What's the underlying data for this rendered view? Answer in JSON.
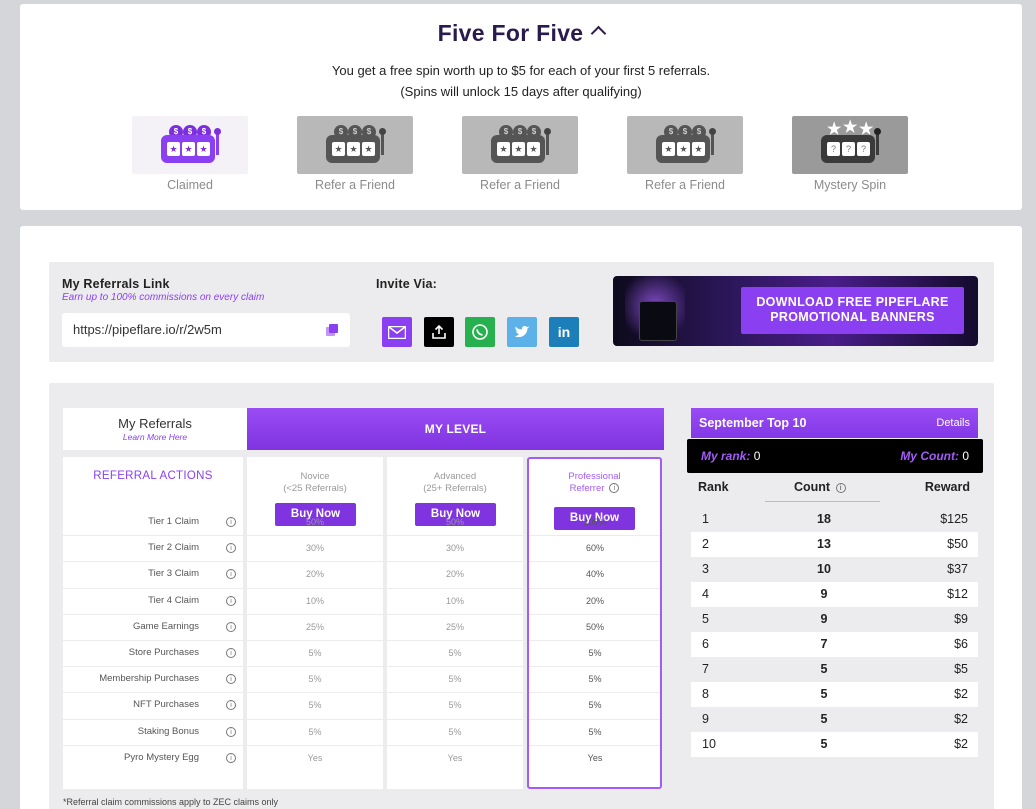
{
  "five_for_five": {
    "title": "Five For Five",
    "line1": "You get a free spin worth up to $5 for each of your first 5 referrals.",
    "line2": "(Spins will unlock 15 days after qualifying)",
    "slots": [
      {
        "label": "Claimed",
        "state": "claimed"
      },
      {
        "label": "Refer a Friend",
        "state": "locked"
      },
      {
        "label": "Refer a Friend",
        "state": "locked"
      },
      {
        "label": "Refer a Friend",
        "state": "locked"
      },
      {
        "label": "Mystery Spin",
        "state": "mystery"
      }
    ]
  },
  "referral": {
    "title": "My Referrals Link",
    "subtitle": "Earn up to 100% commissions on every claim",
    "link": "https://pipeflare.io/r/2w5m",
    "invite_label": "Invite Via:",
    "banner_text_1": "DOWNLOAD FREE PIPEFLARE",
    "banner_text_2": "PROMOTIONAL BANNERS"
  },
  "tabs": {
    "my_referrals": "My Referrals",
    "learn_more": "Learn More Here",
    "my_level": "MY LEVEL"
  },
  "actions_header": "REFERRAL ACTIONS",
  "levels": [
    {
      "name": "Novice",
      "sub": "(<25 Referrals)",
      "buy": "Buy Now"
    },
    {
      "name": "Advanced",
      "sub": "(25+ Referrals)",
      "buy": "Buy Now"
    },
    {
      "name": "Professional",
      "sub": "Referrer",
      "buy": "Buy Now"
    }
  ],
  "actions": [
    {
      "label": "Tier 1 Claim",
      "values": [
        "50%",
        "50%",
        "100%"
      ]
    },
    {
      "label": "Tier 2 Claim",
      "values": [
        "30%",
        "30%",
        "60%"
      ]
    },
    {
      "label": "Tier 3 Claim",
      "values": [
        "20%",
        "20%",
        "40%"
      ]
    },
    {
      "label": "Tier 4 Claim",
      "values": [
        "10%",
        "10%",
        "20%"
      ]
    },
    {
      "label": "Game Earnings",
      "values": [
        "25%",
        "25%",
        "50%"
      ]
    },
    {
      "label": "Store Purchases",
      "values": [
        "5%",
        "5%",
        "5%"
      ]
    },
    {
      "label": "Membership Purchases",
      "values": [
        "5%",
        "5%",
        "5%"
      ]
    },
    {
      "label": "NFT Purchases",
      "values": [
        "5%",
        "5%",
        "5%"
      ]
    },
    {
      "label": "Staking Bonus",
      "values": [
        "5%",
        "5%",
        "5%"
      ]
    },
    {
      "label": "Pyro Mystery Egg",
      "values": [
        "Yes",
        "Yes",
        "Yes"
      ]
    }
  ],
  "footnote": "*Referral claim commissions apply to ZEC claims only",
  "leaderboard": {
    "title": "September Top 10",
    "details": "Details",
    "my_rank_label": "My rank:",
    "my_rank": "0",
    "my_count_label": "My Count:",
    "my_count": "0",
    "col_rank": "Rank",
    "col_count": "Count",
    "col_reward": "Reward",
    "rows": [
      {
        "rank": "1",
        "count": "18",
        "reward": "$125"
      },
      {
        "rank": "2",
        "count": "13",
        "reward": "$50"
      },
      {
        "rank": "3",
        "count": "10",
        "reward": "$37"
      },
      {
        "rank": "4",
        "count": "9",
        "reward": "$12"
      },
      {
        "rank": "5",
        "count": "9",
        "reward": "$9"
      },
      {
        "rank": "6",
        "count": "7",
        "reward": "$6"
      },
      {
        "rank": "7",
        "count": "5",
        "reward": "$5"
      },
      {
        "rank": "8",
        "count": "5",
        "reward": "$2"
      },
      {
        "rank": "9",
        "count": "5",
        "reward": "$2"
      },
      {
        "rank": "10",
        "count": "5",
        "reward": "$2"
      }
    ]
  },
  "colors": {
    "accent": "#8a3ff0",
    "background": "#d5d6da",
    "title": "#2a1b4d"
  }
}
